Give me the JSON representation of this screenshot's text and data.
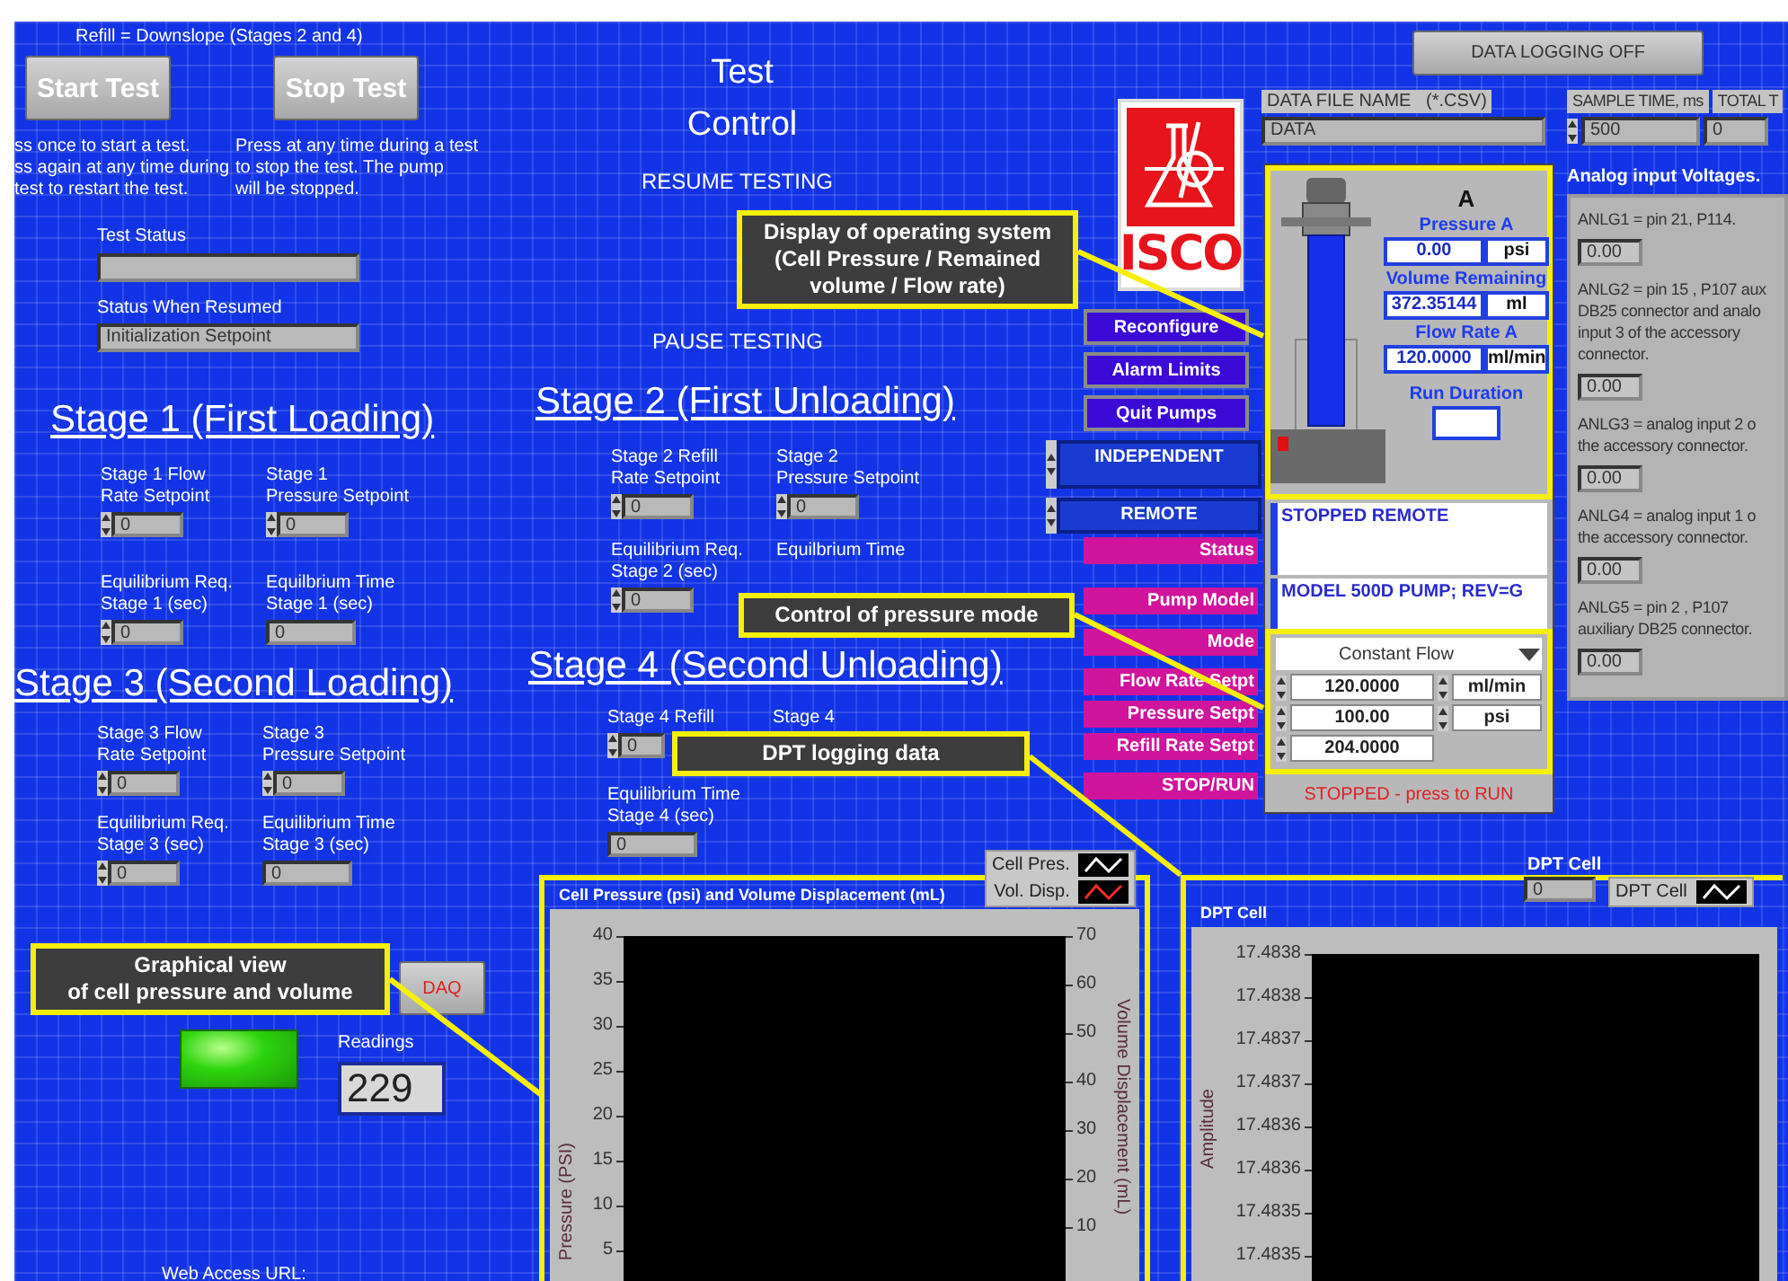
{
  "header_note": "Refill = Downslope (Stages 2 and 4)",
  "test_buttons": [
    {
      "label": "Start Test",
      "description": "ss once to start a test.\nss again at any time during\ntest to restart the test."
    },
    {
      "label": "Stop Test",
      "description": "Press at any time during a test\nto stop the test. The pump\nwill be stopped."
    }
  ],
  "test_status": {
    "label": "Test Status"
  },
  "status_when_resumed": {
    "label": "Status When Resumed",
    "value": "Initialization Setpoint"
  },
  "test_control": {
    "title": "Test\nControl",
    "resume_label": "RESUME TESTING",
    "pause_label": "PAUSE TESTING"
  },
  "stages": [
    {
      "heading": "Stage 1 (First Loading)",
      "fields": [
        {
          "label": "Stage 1 Flow\nRate Setpoint",
          "value": "0",
          "kind": "spinner"
        },
        {
          "label": "Stage 1\nPressure Setpoint",
          "value": "0",
          "kind": "spinner"
        },
        {
          "label": "Equilibrium Req.\nStage 1 (sec)",
          "value": "0",
          "kind": "spinner"
        },
        {
          "label": "Equilbrium Time\nStage 1 (sec)",
          "value": "0",
          "kind": "indicator"
        }
      ]
    },
    {
      "heading": "Stage 2 (First Unloading)",
      "fields": [
        {
          "label": "Stage 2 Refill\nRate Setpoint",
          "value": "0",
          "kind": "spinner"
        },
        {
          "label": "Stage 2\nPressure Setpoint",
          "value": "0",
          "kind": "spinner"
        },
        {
          "label": "Equilibrium Req.\nStage 2 (sec)",
          "value": "0",
          "kind": "spinner"
        },
        {
          "label": "Equilbrium Time",
          "kind": "label"
        }
      ]
    },
    {
      "heading": "Stage 3 (Second Loading)",
      "fields": [
        {
          "label": "Stage 3 Flow\nRate Setpoint",
          "value": "0",
          "kind": "spinner"
        },
        {
          "label": "Stage 3\nPressure Setpoint",
          "value": "0",
          "kind": "spinner"
        },
        {
          "label": "Equilibrium Req.\nStage 3 (sec)",
          "value": "0",
          "kind": "spinner"
        },
        {
          "label": "Equilibrium Time\nStage 3 (sec)",
          "value": "0",
          "kind": "indicator"
        }
      ]
    },
    {
      "heading": "Stage 4 (Second Unloading)",
      "fields": [
        {
          "label": "Stage 4 Refill",
          "value": "0",
          "kind": "spinner"
        },
        {
          "label": "Stage 4",
          "kind": "label"
        },
        {
          "label": "Equilibrium Time\nStage 4 (sec)",
          "value": "0",
          "kind": "indicator"
        }
      ]
    }
  ],
  "logo_text": "ISCO",
  "pump_buttons": [
    "Reconfigure",
    "Alarm Limits",
    "Quit Pumps"
  ],
  "selectors": [
    "INDEPENDENT",
    "REMOTE"
  ],
  "pump_labels": [
    "Status",
    "Pump Model",
    "Mode",
    "Flow  Rate Setpt",
    "Pressure Setpt",
    "Refill Rate Setpt",
    "STOP/RUN"
  ],
  "data_logging_button": "DATA LOGGING OFF",
  "data_file": {
    "label": "DATA FILE NAME   (*.CSV)",
    "value": "DATA"
  },
  "sample_time": {
    "label": "SAMPLE TIME, ms",
    "value": "500"
  },
  "total_time": {
    "label": "TOTAL T",
    "value": "0"
  },
  "pump": {
    "name": "A",
    "readings": [
      {
        "label": "Pressure A",
        "value": "0.00",
        "unit": "psi"
      },
      {
        "label": "Volume Remaining",
        "value": "372.35144",
        "unit": "ml"
      },
      {
        "label": "Flow Rate A",
        "value": "120.0000",
        "unit": "ml/min"
      }
    ],
    "run_duration_label": "Run Duration",
    "status": "STOPPED REMOTE",
    "model": "MODEL 500D PUMP; REV=G",
    "mode": "Constant Flow",
    "setpoints": [
      {
        "value": "120.0000",
        "unit": "ml/min"
      },
      {
        "value": "100.00",
        "unit": "psi"
      },
      {
        "value": "204.0000"
      }
    ],
    "run_state": "STOPPED - press to RUN"
  },
  "analog": {
    "title": "Analog input Voltages.",
    "inputs": [
      {
        "description": "ANLG1 = pin 21, P114.",
        "value": "0.00"
      },
      {
        "description": "ANLG2 = pin 15 , P107 aux\nDB25 connector and analo\ninput 3 of the accessory\nconnector.",
        "value": "0.00"
      },
      {
        "description": "ANLG3 = analog input 2 o\nthe accessory connector.",
        "value": "0.00"
      },
      {
        "description": "ANLG4 = analog input 1 o\nthe accessory connector.",
        "value": "0.00"
      },
      {
        "description": "ANLG5 = pin 2 , P107\nauxiliary DB25 connector.",
        "value": "0.00"
      }
    ]
  },
  "daq_button": "DAQ",
  "indicator_led": {
    "on": true
  },
  "readings": {
    "label": "Readings",
    "value": "229"
  },
  "web_access_label": "Web Access URL:",
  "cell_chart": {
    "title": "Cell Pressure (psi) and Volume Displacement (mL)",
    "y_label": "Pressure (PSI)",
    "y2_label": "Volume Displacement (mL)",
    "y_ticks": [
      "40",
      "35",
      "30",
      "25",
      "20",
      "15",
      "10",
      "5"
    ],
    "y2_ticks": [
      "70",
      "60",
      "50",
      "40",
      "30",
      "20",
      "10"
    ],
    "legend": [
      {
        "name": "Cell Pres.",
        "color": "#ffffff"
      },
      {
        "name": "Vol. Disp.",
        "color": "#ff2a2a"
      }
    ]
  },
  "dpt_chart": {
    "header_label": "DPT Cell",
    "header_value": "0",
    "title": "DPT Cell",
    "y_label": "Amplitude",
    "y_ticks": [
      "17.4838",
      "17.4838",
      "17.4837",
      "17.4837",
      "17.4836",
      "17.4836",
      "17.4835",
      "17.4835"
    ],
    "legend": [
      {
        "name": "DPT Cell",
        "color": "#ffffff"
      }
    ]
  },
  "callouts": [
    "Display of operating system\n(Cell Pressure / Remained\nvolume / Flow rate)",
    "Control of pressure mode",
    "DPT logging data",
    "Graphical view\nof cell pressure and volume"
  ]
}
